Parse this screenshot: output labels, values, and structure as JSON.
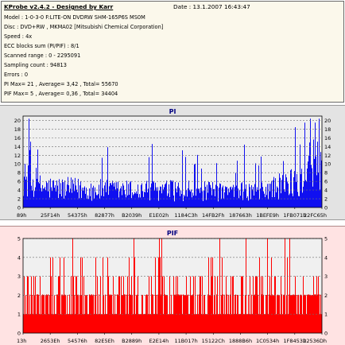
{
  "header": {
    "app_title": "KProbe v2.4.2 - Designed by Karr",
    "date_label": "Date : 13.1.2007 16:43:47"
  },
  "info_lines": [
    "Model : 1-0-3-0 F:LITE-ON DVDRW SHM-165P6S MS0M",
    "Disc : DVD+RW , MKMA02 [Mitsubishi Chemical Corporation]",
    "Speed : 4x",
    "ECC blocks sum (PI/PIF) : 8/1",
    "Scanned range : 0 - 2295091",
    "Sampling count : 94813",
    "Errors : 0",
    "PI Max= 21 , Average= 3,42 , Total= 55670",
    "PIF Max= 5 , Average= 0,36 , Total= 34404"
  ],
  "colors": {
    "pi_bar": "#1010f0",
    "pif_bar": "#ff0000",
    "pi_panel_bg": "#e3e3e3",
    "pif_panel_bg": "#ffe3e3",
    "plot_bg": "#f0f0f0",
    "grid": "#6e6e6e",
    "title": "#000080"
  },
  "chart_data": [
    {
      "type": "bar",
      "title": "PI",
      "xlabel": "",
      "ylabel": "",
      "ylim": [
        0,
        21
      ],
      "yticks": [
        0,
        2,
        4,
        6,
        8,
        10,
        12,
        14,
        16,
        18,
        20
      ],
      "grid": true,
      "right_axis": true,
      "xtick_labels": [
        "89h",
        "25F14h",
        "54375h",
        "82877h",
        "B2039h",
        "E1E02h",
        "1184C3h",
        "14FB2Fh",
        "187663h",
        "1BEFE9h",
        "1FB071h",
        "22FC65h"
      ],
      "summary": {
        "max": 21,
        "average": 3.42,
        "total": 55670
      },
      "profile_anchors": [
        [
          0,
          7
        ],
        [
          0.04,
          5
        ],
        [
          0.1,
          4.5
        ],
        [
          0.3,
          4
        ],
        [
          0.5,
          4
        ],
        [
          0.7,
          3.5
        ],
        [
          0.8,
          4
        ],
        [
          0.86,
          5
        ],
        [
          0.9,
          6
        ],
        [
          0.95,
          9
        ],
        [
          1.0,
          12
        ]
      ]
    },
    {
      "type": "bar",
      "title": "PIF",
      "xlabel": "",
      "ylabel": "",
      "ylim": [
        0,
        5
      ],
      "yticks": [
        0,
        1,
        2,
        3,
        4,
        5
      ],
      "grid": true,
      "right_axis": true,
      "xtick_labels": [
        "13h",
        "2653Eh",
        "54576h",
        "82E5Eh",
        "B2889h",
        "E2E14h",
        "11B017h",
        "15122Ch",
        "1888B6h",
        "1C0534h",
        "1F8453h",
        "22536Dh"
      ],
      "summary": {
        "max": 5,
        "average": 0.36,
        "total": 34404
      }
    }
  ]
}
